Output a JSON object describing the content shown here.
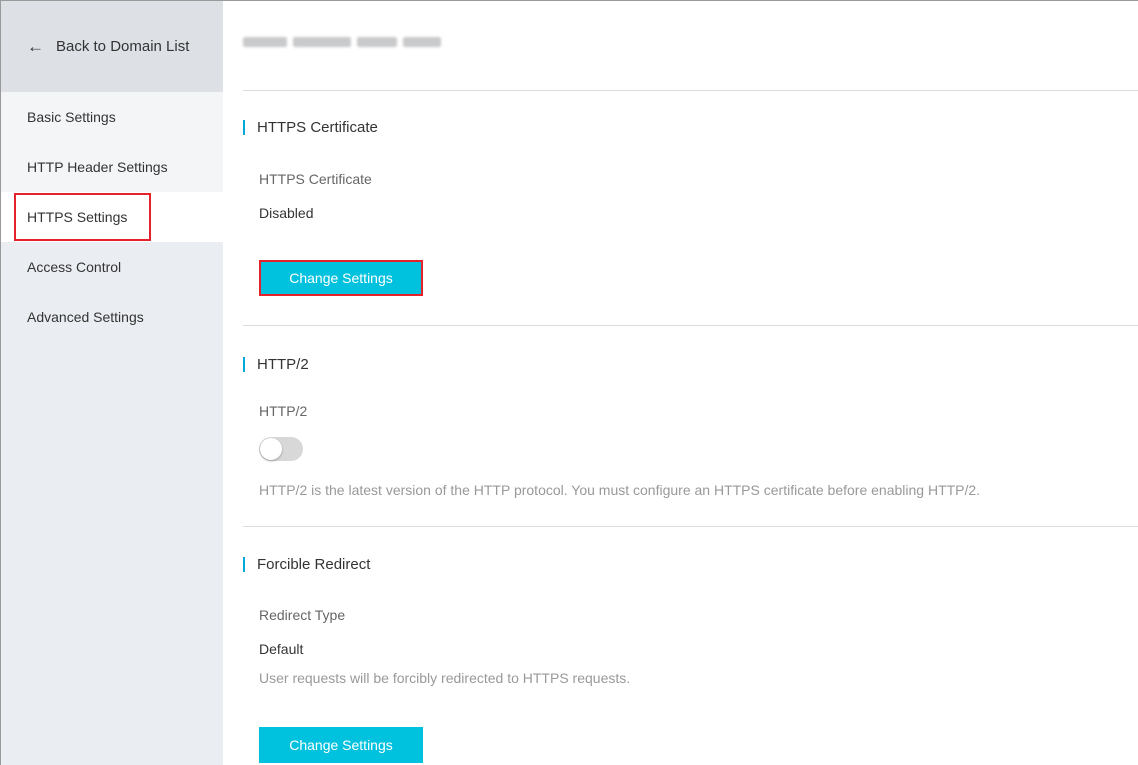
{
  "sidebar": {
    "back_label": "Back to Domain List",
    "items": [
      {
        "label": "Basic Settings"
      },
      {
        "label": "HTTP Header Settings"
      },
      {
        "label": "HTTPS Settings"
      },
      {
        "label": "Access Control"
      },
      {
        "label": "Advanced Settings"
      }
    ],
    "active_index": 2
  },
  "main": {
    "sections": {
      "https_certificate": {
        "title": "HTTPS Certificate",
        "label": "HTTPS Certificate",
        "value": "Disabled",
        "button": "Change Settings"
      },
      "http2": {
        "title": "HTTP/2",
        "label": "HTTP/2",
        "enabled": false,
        "hint": "HTTP/2 is the latest version of the HTTP protocol. You must configure an HTTPS certificate before enabling HTTP/2."
      },
      "forcible_redirect": {
        "title": "Forcible Redirect",
        "label": "Redirect Type",
        "value": "Default",
        "hint": "User requests will be forcibly redirected to HTTPS requests.",
        "button": "Change Settings"
      }
    }
  },
  "colors": {
    "accent": "#00c1de",
    "section_bar": "#00a9d9",
    "highlight": "#e5212b",
    "sidebar_bg": "#eaedf1"
  },
  "icons": {
    "back": "arrow-left-icon"
  }
}
